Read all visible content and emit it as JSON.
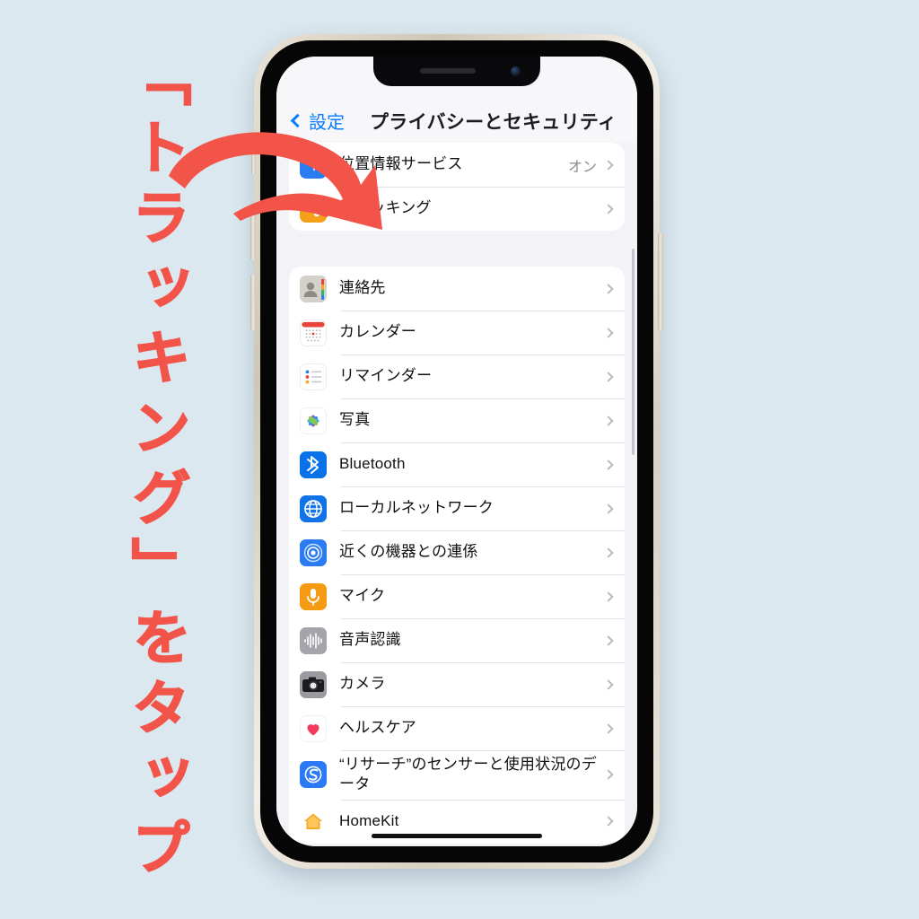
{
  "annotation": {
    "text": "「トラッキング」をタップ",
    "color": "#f2544a"
  },
  "background_color": "#dbe8f0",
  "phone": {
    "status": {
      "notch": "notch",
      "speaker": "earpiece-speaker",
      "camera": "front-camera"
    }
  },
  "navbar": {
    "back_label": "設定",
    "title": "プライバシーとセキュリティ"
  },
  "groups": [
    {
      "rows": [
        {
          "label": "位置情報サービス",
          "value": "オン",
          "icon": "location-icon",
          "icon_class": "ic-loc",
          "glyph": "➤"
        },
        {
          "label": "トラッキング",
          "value": "",
          "icon": "tracking-icon",
          "icon_class": "ic-track",
          "glyph": "⌕"
        }
      ]
    },
    {
      "rows": [
        {
          "label": "連絡先",
          "value": "",
          "icon": "contacts-icon",
          "icon_class": "ic-contacts",
          "glyph": ""
        },
        {
          "label": "カレンダー",
          "value": "",
          "icon": "calendar-icon",
          "icon_class": "ic-calendar",
          "glyph": ""
        },
        {
          "label": "リマインダー",
          "value": "",
          "icon": "reminders-icon",
          "icon_class": "ic-reminders",
          "glyph": ""
        },
        {
          "label": "写真",
          "value": "",
          "icon": "photos-icon",
          "icon_class": "ic-photos",
          "glyph": ""
        },
        {
          "label": "Bluetooth",
          "value": "",
          "icon": "bluetooth-icon",
          "icon_class": "ic-bt",
          "glyph": ""
        },
        {
          "label": "ローカルネットワーク",
          "value": "",
          "icon": "local-network-icon",
          "icon_class": "ic-net",
          "glyph": ""
        },
        {
          "label": "近くの機器との連係",
          "value": "",
          "icon": "nearby-interactions-icon",
          "icon_class": "ic-nearby",
          "glyph": ""
        },
        {
          "label": "マイク",
          "value": "",
          "icon": "microphone-icon",
          "icon_class": "ic-mic",
          "glyph": ""
        },
        {
          "label": "音声認識",
          "value": "",
          "icon": "speech-recognition-icon",
          "icon_class": "ic-speech",
          "glyph": ""
        },
        {
          "label": "カメラ",
          "value": "",
          "icon": "camera-icon",
          "icon_class": "ic-camera",
          "glyph": ""
        },
        {
          "label": "ヘルスケア",
          "value": "",
          "icon": "health-icon",
          "icon_class": "ic-health",
          "glyph": ""
        },
        {
          "label": "“リサーチ”のセンサーと使用状況のデータ",
          "value": "",
          "icon": "research-icon",
          "icon_class": "ic-research",
          "glyph": ""
        },
        {
          "label": "HomeKit",
          "value": "",
          "icon": "homekit-icon",
          "icon_class": "ic-home",
          "glyph": ""
        }
      ]
    }
  ]
}
